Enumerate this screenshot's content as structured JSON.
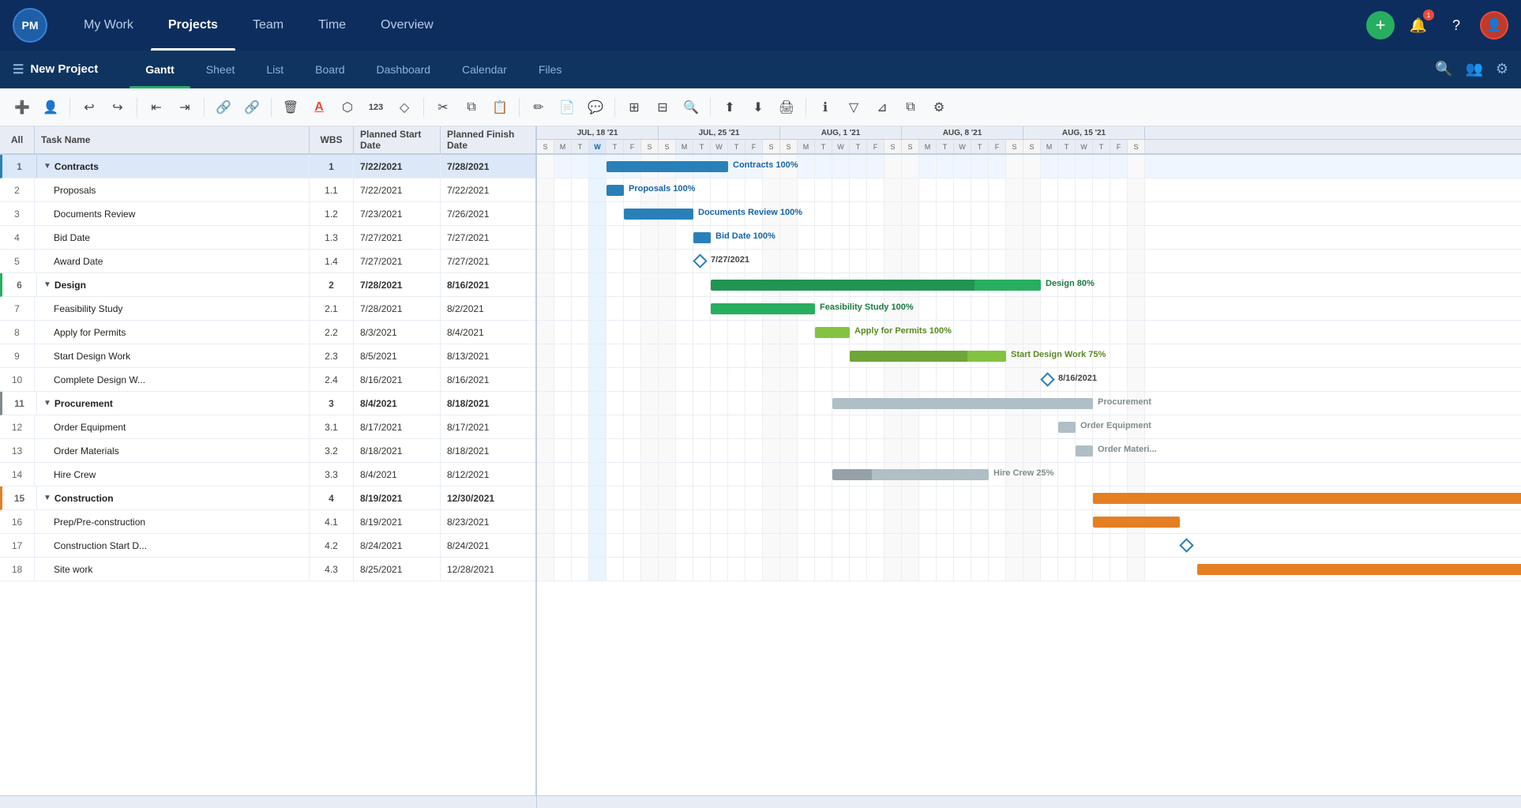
{
  "app": {
    "logo": "PM",
    "nav_items": [
      "My Work",
      "Projects",
      "Team",
      "Time",
      "Overview"
    ],
    "active_nav": "Projects",
    "bell_count": "1"
  },
  "subnav": {
    "project_name": "New Project",
    "tabs": [
      "Gantt",
      "Sheet",
      "List",
      "Board",
      "Dashboard",
      "Calendar",
      "Files"
    ],
    "active_tab": "Gantt"
  },
  "toolbar": {
    "buttons": [
      "add",
      "user",
      "undo",
      "redo",
      "indent-left",
      "indent-right",
      "link",
      "unlink",
      "delete",
      "text-color",
      "shapes",
      "number",
      "diamond",
      "cut",
      "copy",
      "paste",
      "edit",
      "note",
      "comment",
      "grid",
      "columns",
      "zoom",
      "export-up",
      "export-down",
      "print",
      "info",
      "filter-funnel",
      "filter",
      "unknown",
      "settings"
    ]
  },
  "table": {
    "headers": [
      "All",
      "Task Name",
      "WBS",
      "Planned Start Date",
      "Planned Finish Date"
    ],
    "rows": [
      {
        "id": 1,
        "num": "1",
        "name": "Contracts",
        "wbs": "1",
        "start": "7/22/2021",
        "finish": "7/28/2021",
        "type": "group",
        "group": "contracts",
        "indent": 0
      },
      {
        "id": 2,
        "num": "2",
        "name": "Proposals",
        "wbs": "1.1",
        "start": "7/22/2021",
        "finish": "7/22/2021",
        "type": "task",
        "indent": 1
      },
      {
        "id": 3,
        "num": "3",
        "name": "Documents Review",
        "wbs": "1.2",
        "start": "7/23/2021",
        "finish": "7/26/2021",
        "type": "task",
        "indent": 1
      },
      {
        "id": 4,
        "num": "4",
        "name": "Bid Date",
        "wbs": "1.3",
        "start": "7/27/2021",
        "finish": "7/27/2021",
        "type": "milestone",
        "indent": 1
      },
      {
        "id": 5,
        "num": "5",
        "name": "Award Date",
        "wbs": "1.4",
        "start": "7/27/2021",
        "finish": "7/27/2021",
        "type": "milestone",
        "indent": 1
      },
      {
        "id": 6,
        "num": "6",
        "name": "Design",
        "wbs": "2",
        "start": "7/28/2021",
        "finish": "8/16/2021",
        "type": "group",
        "group": "design",
        "indent": 0
      },
      {
        "id": 7,
        "num": "7",
        "name": "Feasibility Study",
        "wbs": "2.1",
        "start": "7/28/2021",
        "finish": "8/2/2021",
        "type": "task",
        "indent": 1
      },
      {
        "id": 8,
        "num": "8",
        "name": "Apply for Permits",
        "wbs": "2.2",
        "start": "8/3/2021",
        "finish": "8/4/2021",
        "type": "task",
        "indent": 1
      },
      {
        "id": 9,
        "num": "9",
        "name": "Start Design Work",
        "wbs": "2.3",
        "start": "8/5/2021",
        "finish": "8/13/2021",
        "type": "task",
        "indent": 1
      },
      {
        "id": 10,
        "num": "10",
        "name": "Complete Design W...",
        "wbs": "2.4",
        "start": "8/16/2021",
        "finish": "8/16/2021",
        "type": "milestone",
        "indent": 1
      },
      {
        "id": 11,
        "num": "11",
        "name": "Procurement",
        "wbs": "3",
        "start": "8/4/2021",
        "finish": "8/18/2021",
        "type": "group",
        "group": "procurement",
        "indent": 0
      },
      {
        "id": 12,
        "num": "12",
        "name": "Order Equipment",
        "wbs": "3.1",
        "start": "8/17/2021",
        "finish": "8/17/2021",
        "type": "task",
        "indent": 1
      },
      {
        "id": 13,
        "num": "13",
        "name": "Order Materials",
        "wbs": "3.2",
        "start": "8/18/2021",
        "finish": "8/18/2021",
        "type": "task",
        "indent": 1
      },
      {
        "id": 14,
        "num": "14",
        "name": "Hire Crew",
        "wbs": "3.3",
        "start": "8/4/2021",
        "finish": "8/12/2021",
        "type": "task",
        "indent": 1
      },
      {
        "id": 15,
        "num": "15",
        "name": "Construction",
        "wbs": "4",
        "start": "8/19/2021",
        "finish": "12/30/2021",
        "type": "group",
        "group": "construction",
        "indent": 0
      },
      {
        "id": 16,
        "num": "16",
        "name": "Prep/Pre-construction",
        "wbs": "4.1",
        "start": "8/19/2021",
        "finish": "8/23/2021",
        "type": "task",
        "indent": 1
      },
      {
        "id": 17,
        "num": "17",
        "name": "Construction Start D...",
        "wbs": "4.2",
        "start": "8/24/2021",
        "finish": "8/24/2021",
        "type": "milestone",
        "indent": 1
      },
      {
        "id": 18,
        "num": "18",
        "name": "Site work",
        "wbs": "4.3",
        "start": "8/25/2021",
        "finish": "12/28/2021",
        "type": "task",
        "indent": 1
      }
    ]
  },
  "gantt": {
    "weeks": [
      {
        "label": "JUL, 18 '21",
        "days": 7
      },
      {
        "label": "JUL, 25 '21",
        "days": 7
      },
      {
        "label": "AUG, 1 '21",
        "days": 7
      },
      {
        "label": "AUG, 8 '21",
        "days": 7
      },
      {
        "label": "AUG, 15 '21",
        "days": 7
      }
    ],
    "day_width": 22,
    "today_col": 3
  }
}
